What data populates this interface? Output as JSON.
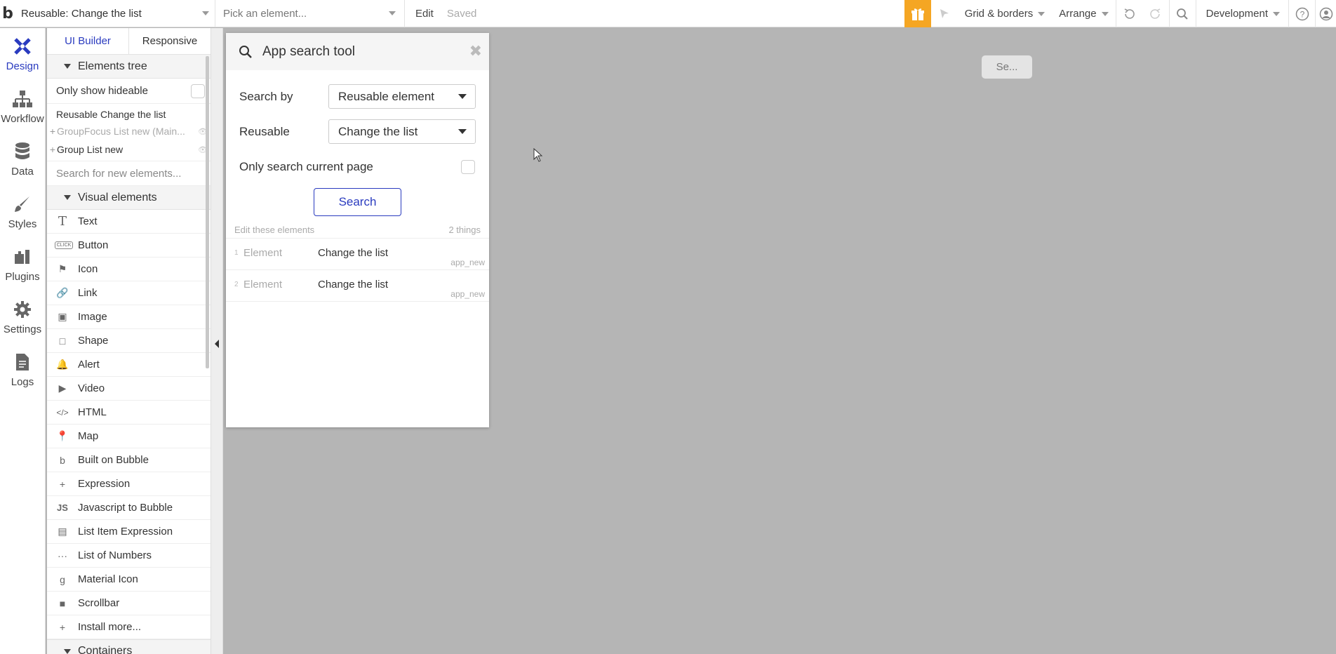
{
  "topbar": {
    "logo": "b",
    "page_select": "Reusable: Change the list",
    "element_select_placeholder": "Pick an element...",
    "edit_label": "Edit",
    "saved_label": "Saved",
    "grid_label": "Grid & borders",
    "arrange_label": "Arrange",
    "env_label": "Development"
  },
  "leftbar": {
    "items": [
      {
        "label": "Design",
        "icon": "design-icon"
      },
      {
        "label": "Workflow",
        "icon": "workflow-icon"
      },
      {
        "label": "Data",
        "icon": "database-icon"
      },
      {
        "label": "Styles",
        "icon": "brush-icon"
      },
      {
        "label": "Plugins",
        "icon": "plugin-icon"
      },
      {
        "label": "Settings",
        "icon": "gear-icon"
      },
      {
        "label": "Logs",
        "icon": "document-icon"
      }
    ]
  },
  "palette": {
    "tabs": [
      "UI Builder",
      "Responsive"
    ],
    "elements_tree_label": "Elements tree",
    "only_show_hideable": "Only show hideable",
    "tree": [
      "Reusable Change the list",
      "GroupFocus List new (Main...",
      "Group List new"
    ],
    "search_placeholder": "Search for new elements...",
    "visual_elements_label": "Visual elements",
    "visual_elements": [
      {
        "label": "Text",
        "icon": "T"
      },
      {
        "label": "Button",
        "icon": "CLICK"
      },
      {
        "label": "Icon",
        "icon": "⚑"
      },
      {
        "label": "Link",
        "icon": "🔗"
      },
      {
        "label": "Image",
        "icon": "▣"
      },
      {
        "label": "Shape",
        "icon": "□"
      },
      {
        "label": "Alert",
        "icon": "🔔"
      },
      {
        "label": "Video",
        "icon": "▶"
      },
      {
        "label": "HTML",
        "icon": "</>"
      },
      {
        "label": "Map",
        "icon": "📍"
      },
      {
        "label": "Built on Bubble",
        "icon": "b"
      },
      {
        "label": "Expression",
        "icon": "+"
      },
      {
        "label": "Javascript to Bubble",
        "icon": "JS"
      },
      {
        "label": "List Item Expression",
        "icon": "▤"
      },
      {
        "label": "List of Numbers",
        "icon": "···"
      },
      {
        "label": "Material Icon",
        "icon": "g"
      },
      {
        "label": "Scrollbar",
        "icon": "■"
      },
      {
        "label": "Install more...",
        "icon": "+"
      }
    ],
    "containers_label": "Containers"
  },
  "canvas": {
    "se_label": "Se..."
  },
  "search_tool": {
    "title": "App search tool",
    "search_by_label": "Search by",
    "search_by_value": "Reusable element",
    "reusable_label": "Reusable",
    "reusable_value": "Change the list",
    "only_current_label": "Only search current page",
    "search_button": "Search",
    "results_header": "Edit these elements",
    "results_count": "2 things",
    "results": [
      {
        "num": "1",
        "type": "Element",
        "name": "Change the list",
        "page": "app_new"
      },
      {
        "num": "2",
        "type": "Element",
        "name": "Change the list",
        "page": "app_new"
      }
    ]
  }
}
